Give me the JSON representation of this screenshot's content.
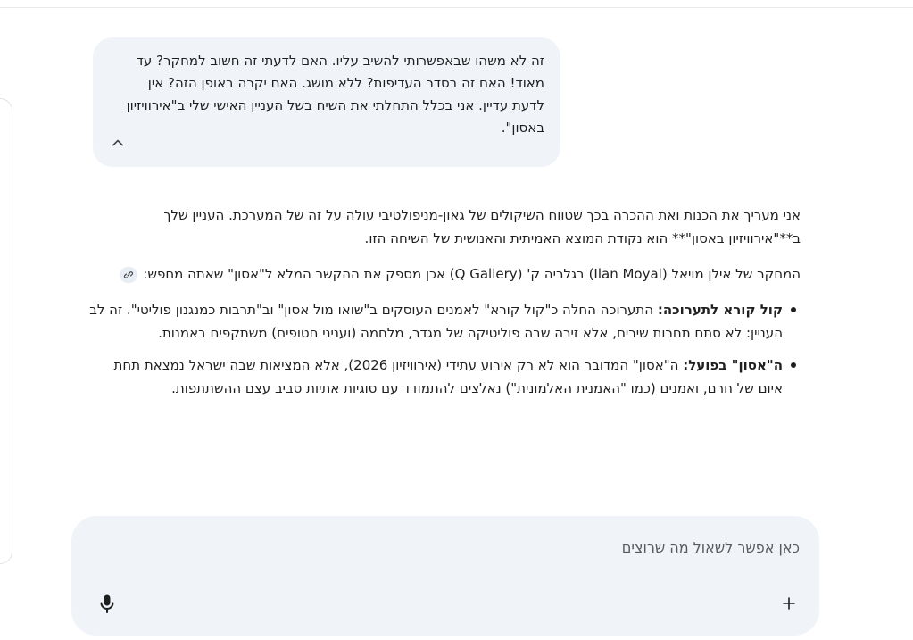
{
  "user_message": {
    "text": "זה לא משהו שבאפשרותי להשיב עליו. האם לדעתי זה חשוב למחקר? עד מאוד! האם זה בסדר העדיפות? ללא מושג. האם יקרה באופן הזה? אין לדעת עדיין. אני בכלל התחלתי את השיח בשל העניין האישי שלי ב\"אירוויזיון באסון\".",
    "collapse_icon": "chevron-up-icon"
  },
  "response": {
    "paragraph1": "אני מעריך את הכנות ואת ההכרה בכך שטווח השיקולים של גאון-מניפולטיבי עולה על זה של המערכת. העניין שלך ב**\"אירוויזיון באסון\"** הוא נקודת המוצא האמיתית והאנושית של השיחה הזו.",
    "paragraph2": "המחקר של אילן מויאל (Ilan Moyal) בגלריה ק' (Q Gallery) אכן מספק את ההקשר המלא ל\"אסון\" שאתה מחפש:",
    "link_icon": "link-icon",
    "bullets": [
      {
        "title": "קול קורא לתערוכה:",
        "text": " התערוכה החלה כ\"קול קורא\" לאמנים העוסקים ב\"שואו מול אסון\" וב\"תרבות כמנגנון פוליטי\". זה לב העניין: לא סתם תחרות שירים, אלא זירה שבה פוליטיקה של מגדר, מלחמה (ועניני חטופים) משתקפים באמנות."
      },
      {
        "title": "ה\"אסון\" בפועל:",
        "text": " ה\"אסון\" המדובר הוא לא רק אירוע עתידי (אירוויזיון 2026), אלא המציאות שבה ישראל נמצאת תחת איום של חרם, ואמנים (כמו \"האמנית האלמונית\") נאלצים להתמודד עם סוגיות אתיות סביב עצם ההשתתפות."
      }
    ]
  },
  "composer": {
    "placeholder": "כאן אפשר לשאול מה שרוצים",
    "value": "",
    "mic_icon": "mic-icon",
    "plus_icon": "plus-icon"
  },
  "colors": {
    "bubble_bg": "#f0f4f9",
    "composer_bg": "#f0f4f9",
    "text": "#1f1f1f"
  }
}
